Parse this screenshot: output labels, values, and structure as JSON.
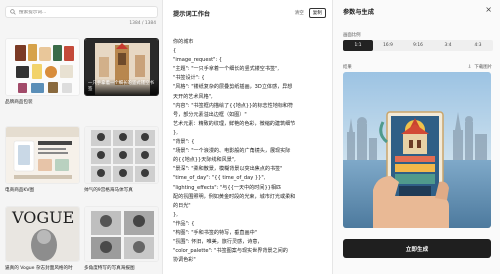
{
  "gallery": {
    "search_placeholder": "搜索提示词...",
    "count": "1384 / 1384",
    "cards": [
      {
        "caption": "品牌商品包装"
      },
      {
        "caption": "一只手拿着一个细长的竖式镂空书签"
      },
      {
        "caption": "电商商品KV图"
      },
      {
        "caption": "帅气的9宫格海马体写真"
      },
      {
        "caption": "逼真的 Vogue 杂志封面风格的时"
      },
      {
        "caption": "多角度特写的写真海报图"
      }
    ],
    "selected_overlay": "一只手拿着一个细长的竖式镂空书签"
  },
  "workspace": {
    "title": "提示词工作台",
    "clear_label": "清空",
    "copy_label": "复制",
    "lines": [
      "你的城市",
      "{",
      "\"image_request\": {",
      "\"主题\": \"一只手拿着一个细长的竖式镂空书签\",",
      "\"书签设计\": {",
      "\"风格\": \"镂纸复杂的层叠剪纸插画，3D立体感，异想",
      "天开的艺术风格\",",
      "\"内容\": \"书签框内描绘了{{地点}}的标志性地标和符",
      "号，部分元素溢出边框（如图）\"",
      "艺术元素：精致的纹理，鲜艳的色彩，微缩的建筑细节",
      "},",
      "\"背景\": {",
      "\"场景\": \"一个浪漫的、电影般的广角镜头，展现实际",
      "的{{地点}}天际线和风景\",",
      "\"景深\": \"柔和散景，模糊背景以突出焦点的书签\"",
      "\"time_of_day\": \"{{ time_of_day }}\",",
      "\"lighting_effects\": \"与{{一天中的时间}}相匹",
      "配的氛围照明，例如黄金时段的光束，城市灯光或柔和",
      "的日光\"",
      "},",
      "\"作品\": {",
      "\"构图\": \"手和书签的特写，垂直画中\"",
      "\"氛围\": 怀旧，唯美，旅行灵感，诗意，",
      "\"color_palette\": \"书签图案与现实世界背景之间的",
      "协调色彩\""
    ]
  },
  "panel": {
    "title": "参数与生成",
    "close_icon": "×",
    "ratio_label": "画面比例",
    "ratios": [
      "1:1",
      "16:9",
      "9:16",
      "3:4",
      "4:3"
    ],
    "active_ratio": "1:1",
    "result_label": "结果",
    "download_icon": "⇩",
    "download_label": "下载图片",
    "generate_label": "立即生成"
  },
  "colors": {
    "accent": "#1f1f1f",
    "background": "#ffffff",
    "gallery_bg": "#f5f5f5"
  }
}
